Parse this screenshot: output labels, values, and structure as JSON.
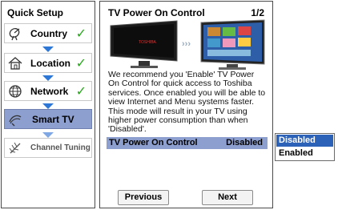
{
  "sidebar": {
    "title": "Quick Setup",
    "steps": [
      {
        "label": "Country",
        "icon": "satellite-dish-icon",
        "done": "✓"
      },
      {
        "label": "Location",
        "icon": "house-icon",
        "done": "✓"
      },
      {
        "label": "Network",
        "icon": "globe-icon",
        "done": "✓"
      },
      {
        "label": "Smart TV",
        "icon": "antenna-icon",
        "done": ""
      },
      {
        "label": "Channel Tuning",
        "icon": "aerial-icon",
        "done": ""
      }
    ]
  },
  "panel": {
    "title": "TV Power On Control",
    "page": "1/2",
    "tv_brand": "TOSHIBA",
    "description": "We recommend you 'Enable' TV Power On Control for quick access to Toshiba services. Once enabled you will be able to view Internet and Menu systems faster. This mode will result in your TV using higher power consumption than when 'Disabled'.",
    "setting": {
      "name": "TV Power On Control",
      "value": "Disabled"
    },
    "buttons": {
      "previous": "Previous",
      "next": "Next"
    }
  },
  "dropdown": {
    "options": [
      "Disabled",
      "Enabled"
    ],
    "selected": "Disabled"
  },
  "colors": {
    "highlight": "#8d9fcf",
    "selected_option": "#2d62b9",
    "check": "#2aa51e",
    "arrow": "#2d78d6"
  }
}
